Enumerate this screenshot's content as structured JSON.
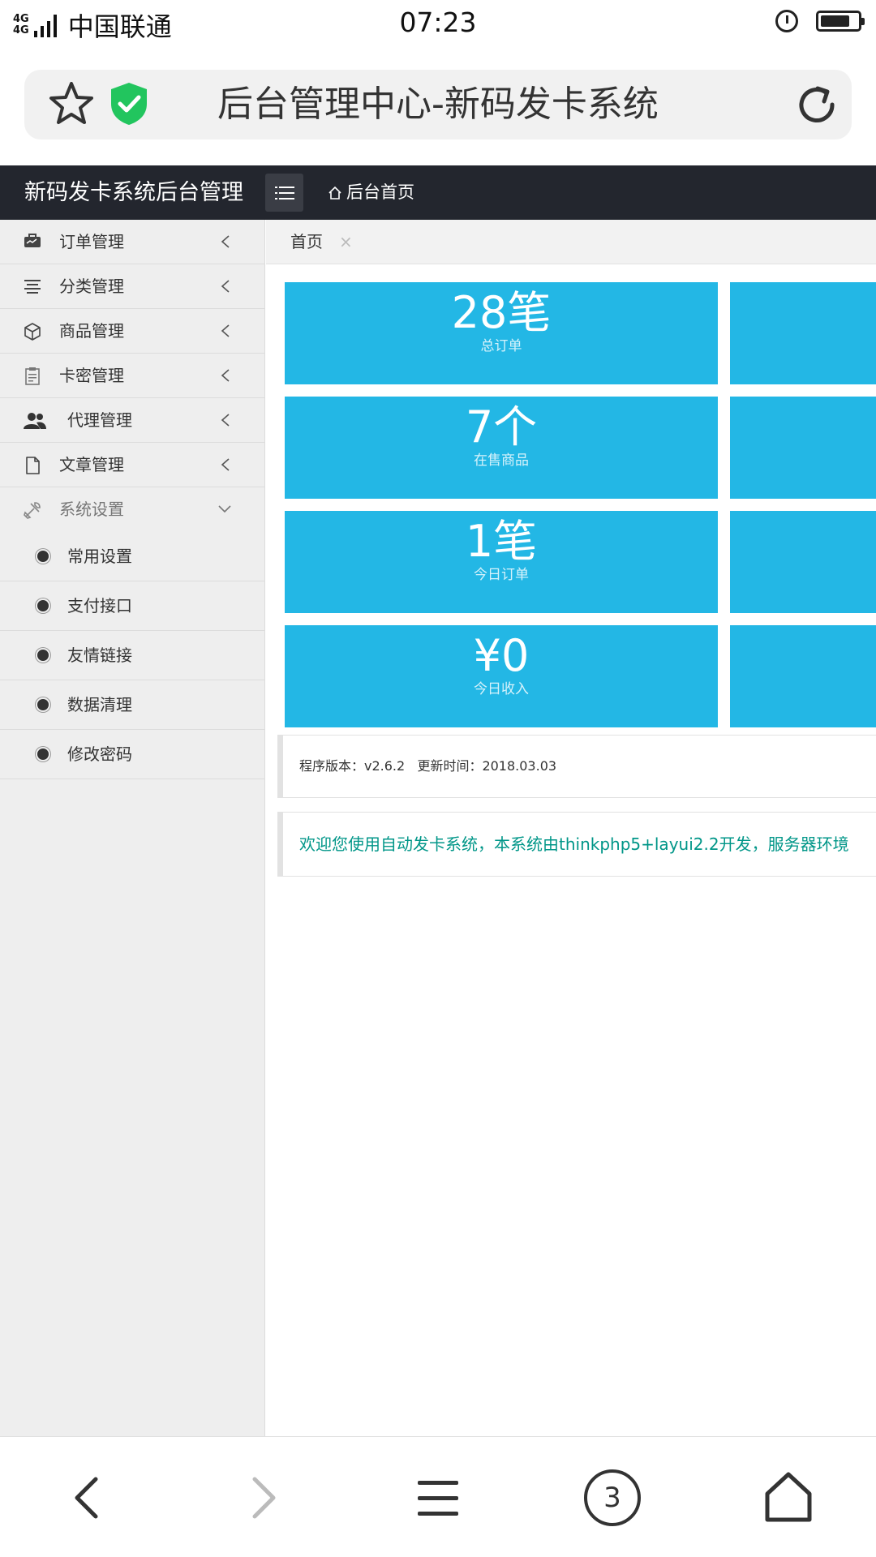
{
  "status_bar": {
    "network": [
      "4G",
      "4G"
    ],
    "carrier": "中国联通",
    "time": "07:23"
  },
  "browser": {
    "page_title": "后台管理中心-新码发卡系统",
    "bookmark_icon": "star-icon",
    "security_icon": "shield-check-icon",
    "reload_icon": "reload-icon"
  },
  "header": {
    "brand": "新码发卡系统后台管理",
    "menu_icon": "list-icon",
    "home_link": "后台首页"
  },
  "sidebar": {
    "items": [
      {
        "label": "订单管理",
        "icon": "order-icon"
      },
      {
        "label": "分类管理",
        "icon": "category-icon"
      },
      {
        "label": "商品管理",
        "icon": "box-icon"
      },
      {
        "label": "卡密管理",
        "icon": "card-icon"
      },
      {
        "label": "代理管理",
        "icon": "users-icon"
      },
      {
        "label": "文章管理",
        "icon": "document-icon"
      },
      {
        "label": "系统设置",
        "icon": "settings-icon"
      }
    ],
    "sub_items": [
      {
        "label": "常用设置"
      },
      {
        "label": "支付接口"
      },
      {
        "label": "友情链接"
      },
      {
        "label": "数据清理"
      },
      {
        "label": "修改密码"
      }
    ]
  },
  "tabs": {
    "active": "首页",
    "close": "×"
  },
  "stats": [
    {
      "value": "28笔",
      "caption": "总订单"
    },
    {
      "value": "7个",
      "caption": "在售商品"
    },
    {
      "value": "1笔",
      "caption": "今日订单"
    },
    {
      "value": "¥0",
      "caption": "今日收入"
    }
  ],
  "version_info": "程序版本：v2.6.2   更新时间：2018.03.03",
  "welcome_text": "欢迎您使用自动发卡系统，本系统由thinkphp5+layui2.2开发，服务器环境",
  "colors": {
    "card_bg": "#23b7e5",
    "header_bg": "#23262e",
    "welcome_text": "#009688"
  },
  "bottom_nav": {
    "tab_count": "3",
    "icons": [
      "back-icon",
      "forward-icon",
      "menu-icon",
      "tabs-icon",
      "home-icon"
    ]
  }
}
